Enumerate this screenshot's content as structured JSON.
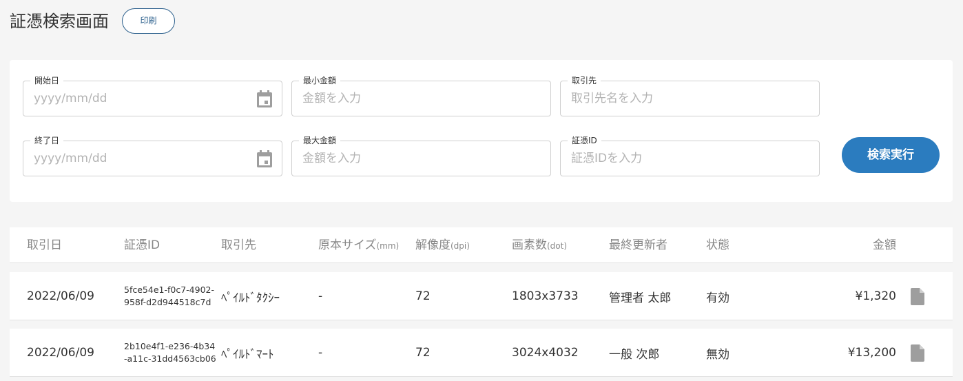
{
  "page": {
    "title": "証憑検索画面",
    "print_label": "印刷"
  },
  "search": {
    "start_date": {
      "label": "開始日",
      "placeholder": "yyyy/mm/dd"
    },
    "end_date": {
      "label": "終了日",
      "placeholder": "yyyy/mm/dd"
    },
    "min_amount": {
      "label": "最小金額",
      "placeholder": "金額を入力"
    },
    "max_amount": {
      "label": "最大金額",
      "placeholder": "金額を入力"
    },
    "partner": {
      "label": "取引先",
      "placeholder": "取引先名を入力"
    },
    "voucher_id": {
      "label": "証憑ID",
      "placeholder": "証憑IDを入力"
    },
    "submit_label": "検索実行"
  },
  "table": {
    "columns": {
      "date": "取引日",
      "id": "証憑ID",
      "partner": "取引先",
      "size": "原本サイズ",
      "size_unit": "(mm)",
      "resolution": "解像度",
      "resolution_unit": "(dpi)",
      "pixels": "画素数",
      "pixels_unit": "(dot)",
      "updater": "最終更新者",
      "status": "状態",
      "amount": "金額"
    },
    "rows": [
      {
        "date": "2022/06/09",
        "id": "5fce54e1-f0c7-4902-958f-d2d944518c7d",
        "partner": "ﾍﾟｲﾙﾄﾞﾀｸｼｰ",
        "size": "-",
        "resolution": "72",
        "pixels": "1803x3733",
        "updater": "管理者 太郎",
        "status": "有効",
        "amount": "¥1,320"
      },
      {
        "date": "2022/06/09",
        "id": "2b10e4f1-e236-4b34-a11c-31dd4563cb06",
        "partner": "ﾍﾟｲﾙﾄﾞﾏｰﾄ",
        "size": "-",
        "resolution": "72",
        "pixels": "3024x4032",
        "updater": "一般 次郎",
        "status": "無効",
        "amount": "¥13,200"
      }
    ]
  },
  "colors": {
    "accent": "#2b7cbf",
    "outline_button": "#2b5f8c",
    "icon_gray": "#9e9e9e"
  },
  "icons": {
    "date_picker": "calendar-icon",
    "row_action": "document-icon"
  }
}
